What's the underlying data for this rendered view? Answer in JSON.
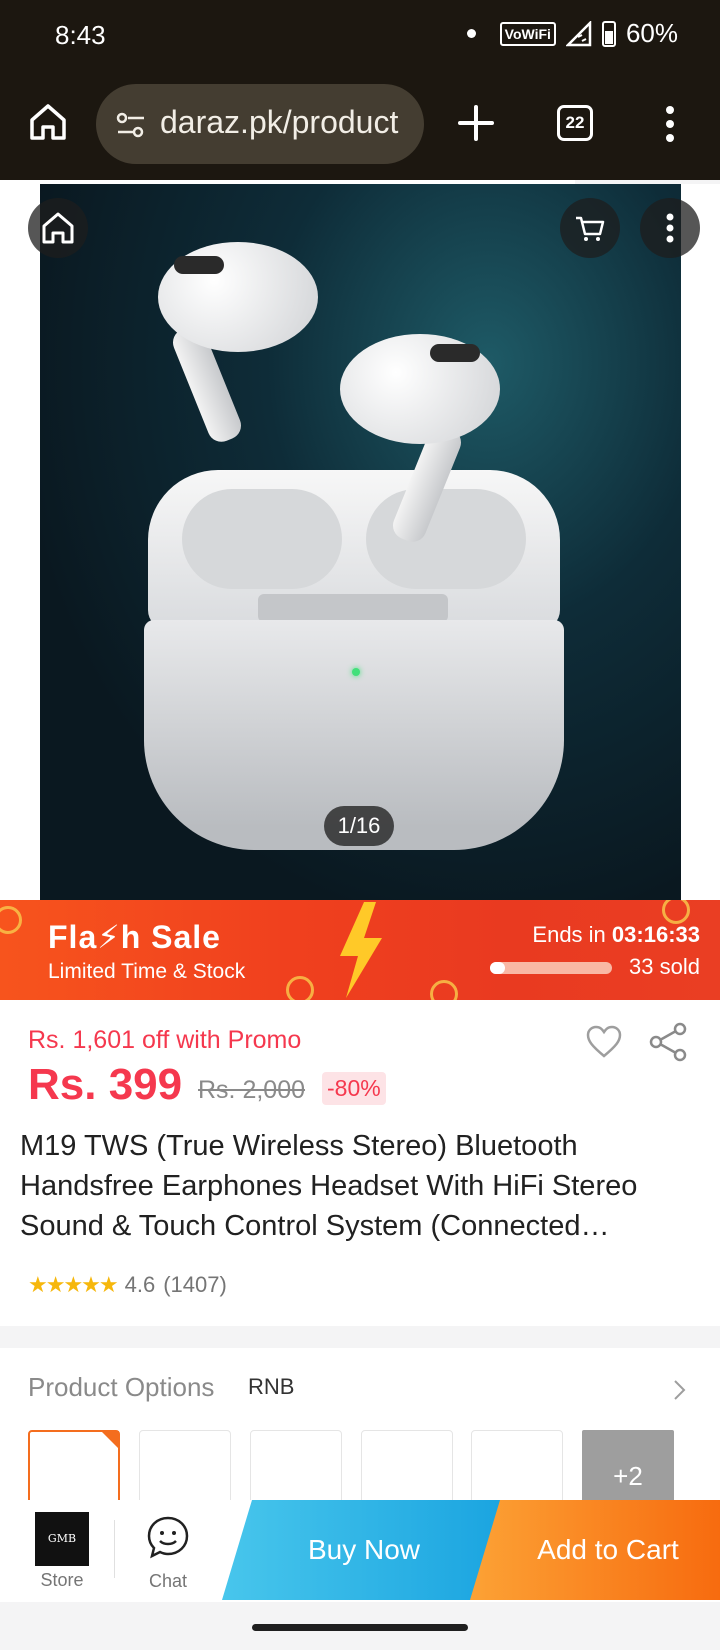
{
  "status_bar": {
    "time": "8:43",
    "network_badge": "VoWiFi",
    "battery": "60%"
  },
  "browser": {
    "url": "daraz.pk/product",
    "tab_count": "22",
    "icons": [
      "home-icon",
      "site-settings-icon",
      "new-tab-icon",
      "tab-switcher-icon",
      "overflow-menu-icon"
    ]
  },
  "gallery": {
    "counter": "1/16",
    "icons": [
      "home-icon",
      "cart-icon",
      "more-icon"
    ]
  },
  "flash_sale": {
    "title": "Fla⚡h Sale",
    "subtitle": "Limited Time & Stock",
    "ends_in_label": "Ends in",
    "countdown": "03:16:33",
    "sold_text": "33 sold",
    "sold_progress": 0.12
  },
  "product": {
    "promo_text": "Rs. 1,601 off with Promo",
    "price": "Rs. 399",
    "original_price": "Rs. 2,000",
    "discount": "-80%",
    "title": "M19 TWS (True Wireless Stereo) Bluetooth Handsfree Earphones Headset With HiFi Stereo Sound & Touch Control System (Connected…",
    "stars": "★★★★★",
    "rating": "4.6",
    "reviews": "(1407)"
  },
  "options": {
    "label": "Product Options",
    "value": "RNB",
    "more": "+2"
  },
  "bottom_bar": {
    "store_label": "Store",
    "store_logo_text": "GMB",
    "chat_label": "Chat",
    "buy_now": "Buy Now",
    "add_to_cart": "Add to Cart"
  },
  "colors": {
    "accent_red": "#f5384e",
    "flash_orange": "#f0401e",
    "buy_blue": "#1aa4e0",
    "cart_orange": "#f76b0f"
  }
}
